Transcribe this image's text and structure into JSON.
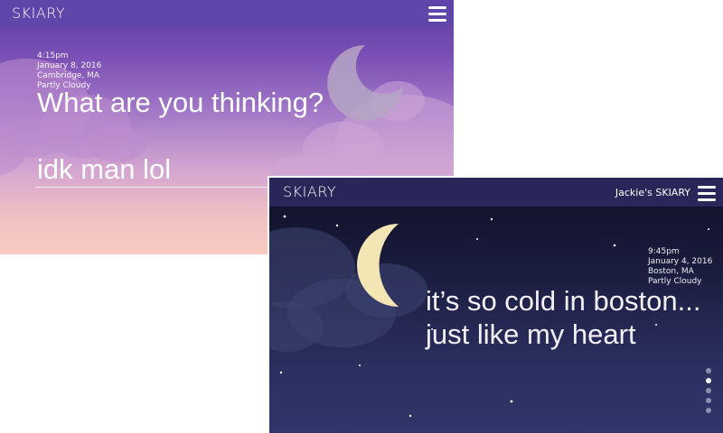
{
  "screens": [
    {
      "theme": "dusk",
      "brand": "SKIARY",
      "meta": {
        "time": "4:15pm",
        "date": "January 8, 2016",
        "location": "Cambridge, MA",
        "weather": "Partly Cloudy"
      },
      "prompt": "What are you thinking?",
      "entry_value": "idk man lol",
      "menu_icon": "hamburger-icon"
    },
    {
      "theme": "night",
      "brand": "SKIARY",
      "owner_label": "Jackie's SKIARY",
      "meta": {
        "time": "9:45pm",
        "date": "January 4, 2016",
        "location": "Boston, MA",
        "weather": "Partly Cloudy"
      },
      "entry_lines": [
        "it’s so cold in boston...",
        "just like my heart"
      ],
      "menu_icon": "hamburger-icon",
      "pagination": {
        "count": 5,
        "active_index": 1
      }
    }
  ],
  "colors": {
    "dusk_top": "#5b3e9e",
    "dusk_bottom": "#f8cbc1",
    "night_top": "#0f0f24",
    "night_bottom": "#30356a",
    "moon_night": "#f3e6b4",
    "moon_dusk": "#b6a6c4"
  }
}
